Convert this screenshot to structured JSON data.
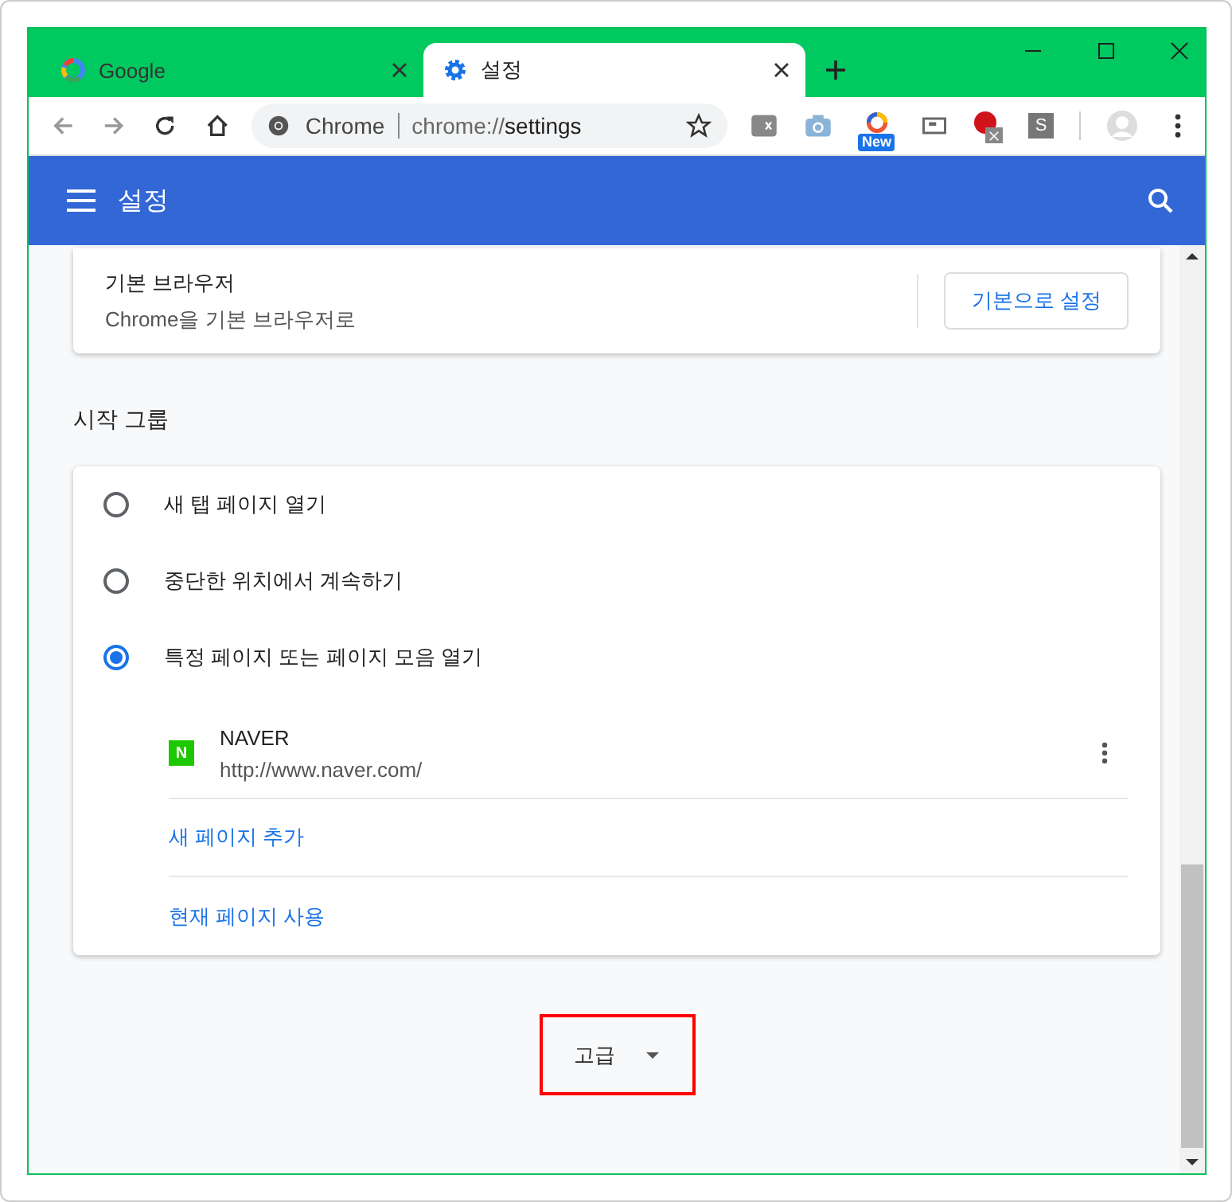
{
  "tabs": [
    {
      "title": "Google",
      "kind": "google",
      "selected": false
    },
    {
      "title": "설정",
      "kind": "gear",
      "selected": true
    }
  ],
  "address_bar": {
    "site": "Chrome",
    "url_scheme": "chrome://",
    "url_path": "settings"
  },
  "extensions": [
    {
      "kind": "ex"
    },
    {
      "kind": "camera"
    },
    {
      "kind": "new",
      "badge": "New"
    },
    {
      "kind": "screen"
    },
    {
      "kind": "red"
    },
    {
      "kind": "letter",
      "letter": "S"
    }
  ],
  "header": {
    "title": "설정"
  },
  "default_browser": {
    "title": "기본 브라우저",
    "subtitle": "Chrome을 기본 브라우저로",
    "button": "기본으로 설정"
  },
  "startup": {
    "heading": "시작 그룹",
    "options": [
      {
        "label": "새 탭 페이지 열기",
        "selected": false
      },
      {
        "label": "중단한 위치에서 계속하기",
        "selected": false
      },
      {
        "label": "특정 페이지 또는 페이지 모음 열기",
        "selected": true
      }
    ],
    "pages": [
      {
        "name": "NAVER",
        "url": "http://www.naver.com/",
        "favicon_letter": "N"
      }
    ],
    "links": [
      "새 페이지 추가",
      "현재 페이지 사용"
    ]
  },
  "advanced": {
    "label": "고급",
    "highlighted": true
  }
}
